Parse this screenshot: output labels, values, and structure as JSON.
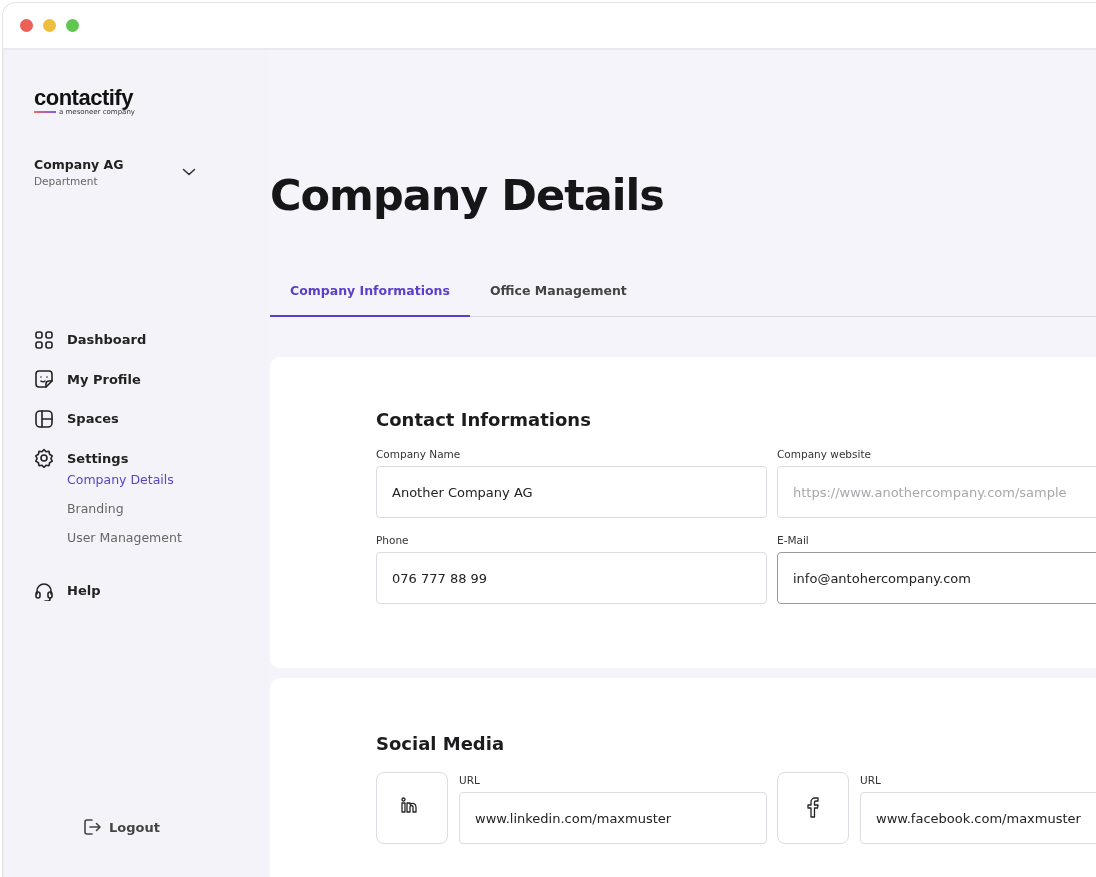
{
  "brand": {
    "name": "contactify",
    "tagline": "a mesoneer company"
  },
  "account": {
    "company": "Company AG",
    "department": "Department"
  },
  "nav": [
    {
      "label": "Dashboard",
      "selected": false
    },
    {
      "label": "My Profile",
      "selected": false
    },
    {
      "label": "Spaces",
      "selected": false
    },
    {
      "label": "Settings",
      "selected": false,
      "children": [
        {
          "label": "Company Details",
          "selected": true
        },
        {
          "label": "Branding",
          "selected": false
        },
        {
          "label": "User Management",
          "selected": false
        }
      ]
    },
    {
      "label": "Help",
      "selected": false
    }
  ],
  "logout": "Logout",
  "page_title": "Company Details",
  "tabs": [
    {
      "label": "Company Informations",
      "selected": true
    },
    {
      "label": "Office Management",
      "selected": false
    }
  ],
  "contact": {
    "title": "Contact Informations",
    "fields": [
      {
        "label": "Company Name",
        "value": "Another Company AG"
      },
      {
        "label": "Company website",
        "placeholder": "https://www.anothercompany.com/sample"
      },
      {
        "label": "Phone",
        "value": "076 777 88 99"
      },
      {
        "label": "E-Mail",
        "value": "info@antohercompany.com",
        "focused": true
      }
    ]
  },
  "social": {
    "title": "Social Media",
    "links": [
      {
        "label": "URL",
        "value": "www.linkedin.com/maxmuster"
      },
      {
        "label": "URL",
        "value": "www.facebook.com/maxmuster"
      }
    ]
  }
}
